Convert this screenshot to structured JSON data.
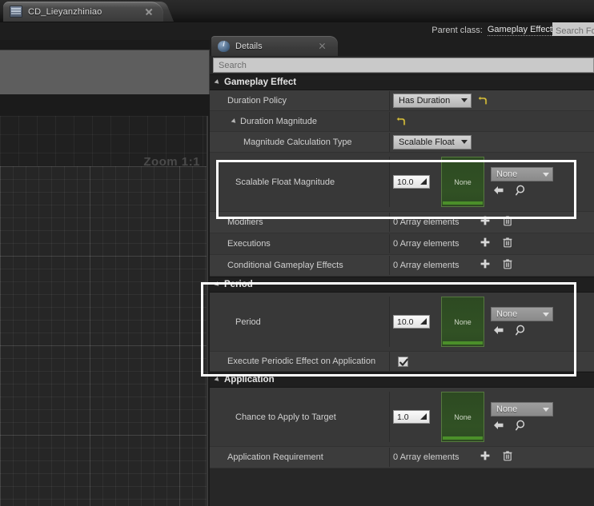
{
  "window": {
    "tab_title": "CD_Lieyanzhiniao",
    "tab_icon": "blueprint-book-icon",
    "close_icon": "close-icon"
  },
  "toolbar": {
    "parent_class_label": "Parent class:",
    "parent_class_value": "Gameplay Effect",
    "search_placeholder": "Search Fo"
  },
  "viewport": {
    "zoom_label": "Zoom 1:1"
  },
  "details": {
    "tab_label": "Details",
    "tab_icon": "details-info-icon",
    "close_icon": "close-icon",
    "search_placeholder": "Search",
    "sections": [
      {
        "id": "gameplay-effect",
        "title": "Gameplay Effect",
        "rows": [
          {
            "id": "duration-policy",
            "label": "Duration Policy",
            "type": "combo-reset",
            "value": "Has Duration",
            "reset_icon": "reset-arrow-icon"
          },
          {
            "id": "duration-magnitude",
            "label": "Duration Magnitude",
            "type": "group-reset",
            "reset_icon": "reset-arrow-icon"
          },
          {
            "id": "magnitude-calculation-type",
            "label": "Magnitude Calculation Type",
            "type": "combo",
            "value": "Scalable Float"
          },
          {
            "id": "scalable-float-magnitude",
            "label": "Scalable Float Magnitude",
            "type": "scalable-float",
            "number": "10.0",
            "thumb_text": "None",
            "asset_value": "None",
            "back_icon": "back-arrow-icon",
            "browse_icon": "browse-magnifier-icon",
            "highlighted": true
          },
          {
            "id": "modifiers",
            "label": "Modifiers",
            "type": "array",
            "value": "0 Array elements",
            "add_icon": "plus-icon",
            "delete_icon": "trash-icon"
          },
          {
            "id": "executions",
            "label": "Executions",
            "type": "array",
            "value": "0 Array elements",
            "add_icon": "plus-icon",
            "delete_icon": "trash-icon"
          },
          {
            "id": "conditional-gameplay-effects",
            "label": "Conditional Gameplay Effects",
            "type": "array",
            "value": "0 Array elements",
            "add_icon": "plus-icon",
            "delete_icon": "trash-icon"
          }
        ]
      },
      {
        "id": "period",
        "title": "Period",
        "rows": [
          {
            "id": "period",
            "label": "Period",
            "type": "scalable-float",
            "number": "10.0",
            "thumb_text": "None",
            "asset_value": "None",
            "back_icon": "back-arrow-icon",
            "browse_icon": "browse-magnifier-icon"
          },
          {
            "id": "execute-periodic-effect-on-application",
            "label": "Execute Periodic Effect on Application",
            "type": "checkbox",
            "checked": true,
            "check_icon": "checkmark-icon"
          }
        ]
      },
      {
        "id": "application",
        "title": "Application",
        "rows": [
          {
            "id": "chance-to-apply-to-target",
            "label": "Chance to Apply to Target",
            "type": "scalable-float",
            "number": "1.0",
            "thumb_text": "None",
            "asset_value": "None",
            "back_icon": "back-arrow-icon",
            "browse_icon": "browse-magnifier-icon"
          },
          {
            "id": "application-requirement",
            "label": "Application Requirement",
            "type": "array",
            "value": "0 Array elements",
            "add_icon": "plus-icon",
            "delete_icon": "trash-icon"
          }
        ]
      }
    ]
  },
  "colors": {
    "highlight_box": "#ffffff",
    "asset_thumb_green": "#315124",
    "asset_thumb_bar": "#4b8f2a",
    "reset_arrow_yellow": "#d9c34a",
    "panel_bg": "#3c3c3c",
    "section_header_bg": "#1f1f1f"
  }
}
